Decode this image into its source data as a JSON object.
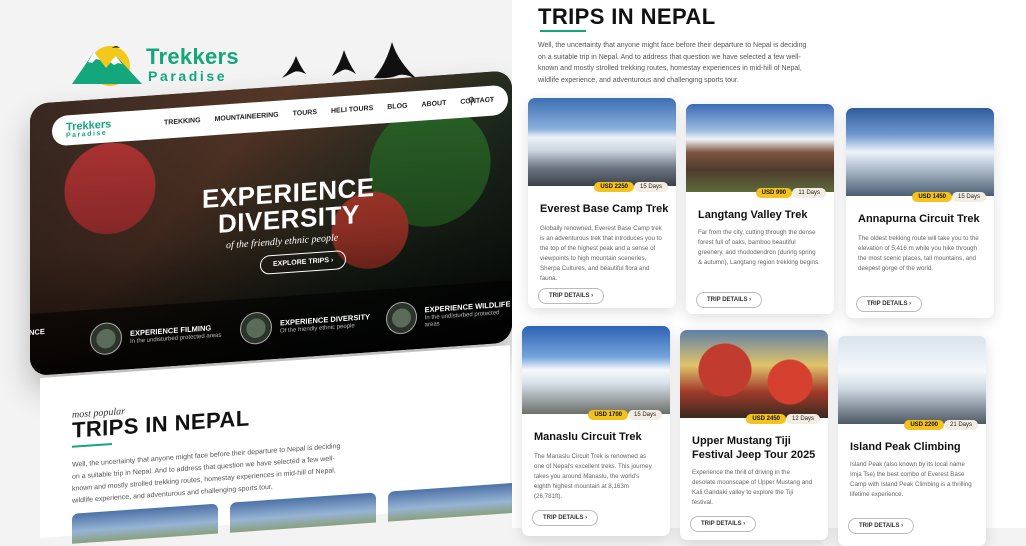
{
  "brand": {
    "name_top": "Trekkers",
    "name_bottom": "Paradise",
    "accent": "#14a77b"
  },
  "hero": {
    "nav": {
      "logo_top": "Trekkers",
      "logo_bottom": "Paradise",
      "items": [
        "TREKKING",
        "MOUNTAINEERING",
        "TOURS",
        "HELI TOURS",
        "BLOG",
        "ABOUT",
        "CONTACT"
      ],
      "icons": [
        "search-icon",
        "more-icon"
      ]
    },
    "title_l1": "EXPERIENCE",
    "title_l2": "DIVERSITY",
    "subtitle": "of the friendly ethnic people",
    "button": "EXPLORE TRIPS ›",
    "features": [
      {
        "title": "EXPERIENCE FILMING",
        "text": "In the undisturbed protected areas"
      },
      {
        "title": "EXPERIENCE DIVERSITY",
        "text": "Of the friendly ethnic people"
      },
      {
        "title": "EXPERIENCE WILDLIFE",
        "text": "In the undisturbed protected areas"
      }
    ],
    "edge_text": "ENCE"
  },
  "popular": {
    "label": "most popular",
    "title": "TRIPS IN NEPAL",
    "desc": "Well, the uncertainty that anyone might face before their departure to Nepal is deciding on a suitable trip in Nepal. And to address that question we have selected a few well-known and mostly strolled trekking routes, homestay experiences in mid-hill of Nepal, wildlife experience, and adventurous and challenging sports tour."
  },
  "trips": [
    {
      "title": "Everest Base Camp Trek",
      "price": "USD 2250",
      "days": "15 Days",
      "desc": "Globally renowned, Everest Base Camp trek is an adventurous trek that introduces you to the top of the highest peak and a sense of viewpoints to high mountain sceneries, Sherpa Cultures, and beautiful flora and fauna.",
      "button": "TRIP DETAILS ›"
    },
    {
      "title": "Langtang Valley Trek",
      "price": "USD 990",
      "days": "11 Days",
      "desc": "Far from the city, cutting through the dense forest full of oaks, bamboo beautiful greenery, and rhododendron (during spring & autumn), Langtang region trekking begins.",
      "button": "TRIP DETAILS ›"
    },
    {
      "title": "Annapurna Circuit Trek",
      "price": "USD 1450",
      "days": "15 Days",
      "desc": "The oldest trekking route will take you to the elevation of 5,416 m while you hike through the most scenic places, tall mountains, and deepest gorge of the world.",
      "button": "TRIP DETAILS ›"
    },
    {
      "title": "Manaslu Circuit Trek",
      "price": "USD 1700",
      "days": "15 Days",
      "desc": "The Manaslu Circuit Trek is renowned as one of Nepal's excellent treks. This journey takes you around Manaslu, the world's eighth highest mountain at 8,163m (26,781ft).",
      "button": "TRIP DETAILS ›"
    },
    {
      "title": "Upper Mustang Tiji Festival Jeep Tour 2025",
      "price": "USD 2450",
      "days": "12 Days",
      "desc": "Experience the thrill of driving in the desolate moonscape of Upper Mustang and Kali Gandaki valley to explore the Tiji festival.",
      "button": "TRIP DETAILS ›"
    },
    {
      "title": "Island Peak Climbing",
      "price": "USD 2200",
      "days": "21 Days",
      "desc": "Island Peak (also known by its local name Imja Tse) the best combo of Everest Base Camp with Island Peak Climbing is a thrilling lifetime experience.",
      "button": "TRIP DETAILS ›"
    }
  ]
}
